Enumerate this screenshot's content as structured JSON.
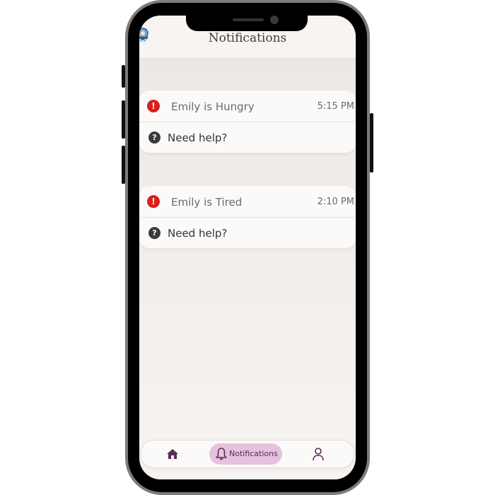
{
  "header": {
    "title": "Notifications",
    "logo_icon": "baby-logo-icon"
  },
  "notifications": [
    {
      "icon": "alert-icon",
      "icon_glyph": "!",
      "text": "Emily is Hungry",
      "time": "5:15 PM",
      "help_icon_glyph": "?",
      "help_label": "Need help?"
    },
    {
      "icon": "alert-icon",
      "icon_glyph": "!",
      "text": "Emily is Tired",
      "time": "2:10 PM",
      "help_icon_glyph": "?",
      "help_label": "Need help?"
    }
  ],
  "bottom_nav": {
    "home_icon": "home-icon",
    "notifications_label": "Notifications",
    "notifications_icon": "bell-icon",
    "profile_icon": "profile-icon"
  },
  "colors": {
    "accent": "#e5c2de",
    "accent_text": "#5a2d55",
    "alert": "#d71f1f",
    "nav_icon": "#5a2d55"
  }
}
